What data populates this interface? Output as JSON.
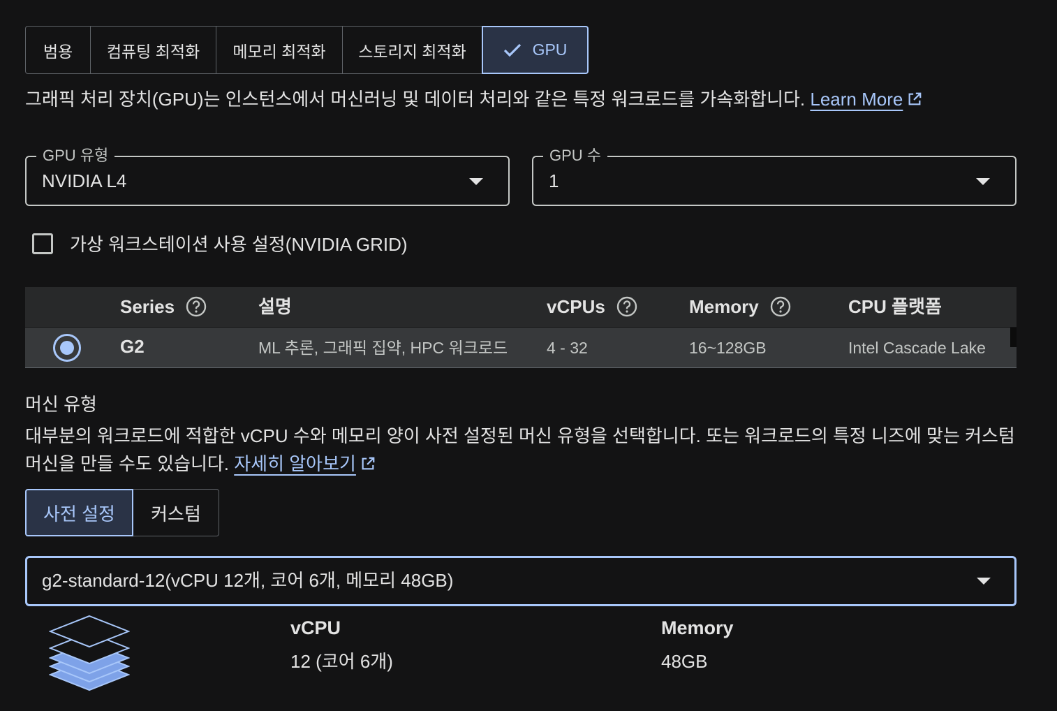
{
  "family_tabs": [
    {
      "label": "범용",
      "selected": false
    },
    {
      "label": "컴퓨팅 최적화",
      "selected": false
    },
    {
      "label": "메모리 최적화",
      "selected": false
    },
    {
      "label": "스토리지 최적화",
      "selected": false
    },
    {
      "label": "GPU",
      "selected": true
    }
  ],
  "gpu_description": "그래픽 처리 장치(GPU)는 인스턴스에서 머신러닝 및 데이터 처리와 같은 특정 워크로드를 가속화합니다.",
  "gpu_learn_more": "Learn More",
  "gpu_type": {
    "label": "GPU 유형",
    "value": "NVIDIA L4"
  },
  "gpu_count": {
    "label": "GPU 수",
    "value": "1"
  },
  "virtual_workstation": {
    "label": "가상 워크스테이션 사용 설정(NVIDIA GRID)",
    "checked": false
  },
  "series_table": {
    "headers": {
      "series": "Series",
      "description": "설명",
      "vcpus": "vCPUs",
      "memory": "Memory",
      "cpu_platform": "CPU 플랫폼"
    },
    "rows": [
      {
        "series": "G2",
        "description": "ML 추론, 그래픽 집약, HPC 워크로드",
        "vcpus": "4 - 32",
        "memory": "16~128GB",
        "cpu_platform": "Intel Cascade Lake",
        "selected": true
      }
    ]
  },
  "machine_type": {
    "title": "머신 유형",
    "description": "대부분의 워크로드에 적합한 vCPU 수와 메모리 양이 사전 설정된 머신 유형을 선택합니다. 또는 워크로드의 특정 니즈에 맞는 커스텀 머신을 만들 수도 있습니다.",
    "learn_more": "자세히 알아보기",
    "preset_label": "사전 설정",
    "custom_label": "커스텀",
    "selected_value": "g2-standard-12(vCPU 12개, 코어 6개, 메모리 48GB)",
    "vcpu_heading": "vCPU",
    "vcpu_value": "12 (코어 6개)",
    "memory_heading": "Memory",
    "memory_value": "48GB"
  },
  "colors": {
    "accent": "#a8c7fa",
    "background": "#131314",
    "selected_bg": "#2a3346"
  }
}
